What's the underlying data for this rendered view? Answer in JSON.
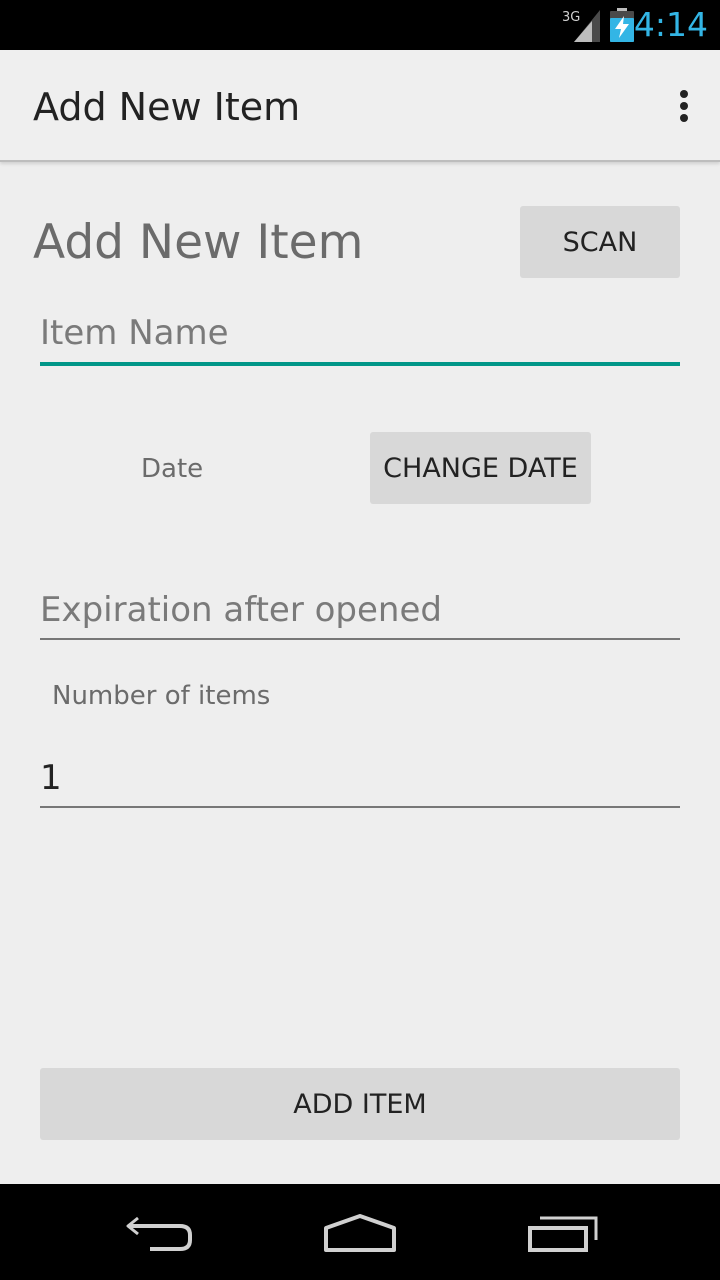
{
  "status_bar": {
    "network_label": "3G",
    "time": "4:14",
    "signal_icon": "signal-icon",
    "battery_icon": "battery-charging-icon"
  },
  "action_bar": {
    "title": "Add New Item",
    "overflow_icon": "overflow-menu-icon"
  },
  "form": {
    "heading": "Add New Item",
    "scan_label": "SCAN",
    "item_name_placeholder": "Item Name",
    "date_label": "Date",
    "change_date_label": "CHANGE DATE",
    "expiration_placeholder": "Expiration after opened",
    "count_label": "Number of items",
    "count_value": "1",
    "add_item_label": "ADD ITEM"
  },
  "nav_bar": {
    "back_icon": "back-icon",
    "home_icon": "home-icon",
    "recents_icon": "recents-icon"
  },
  "colors": {
    "accent": "#009688",
    "clock": "#33b5e5",
    "button_bg": "#d8d8d8",
    "background": "#eeeeee"
  }
}
